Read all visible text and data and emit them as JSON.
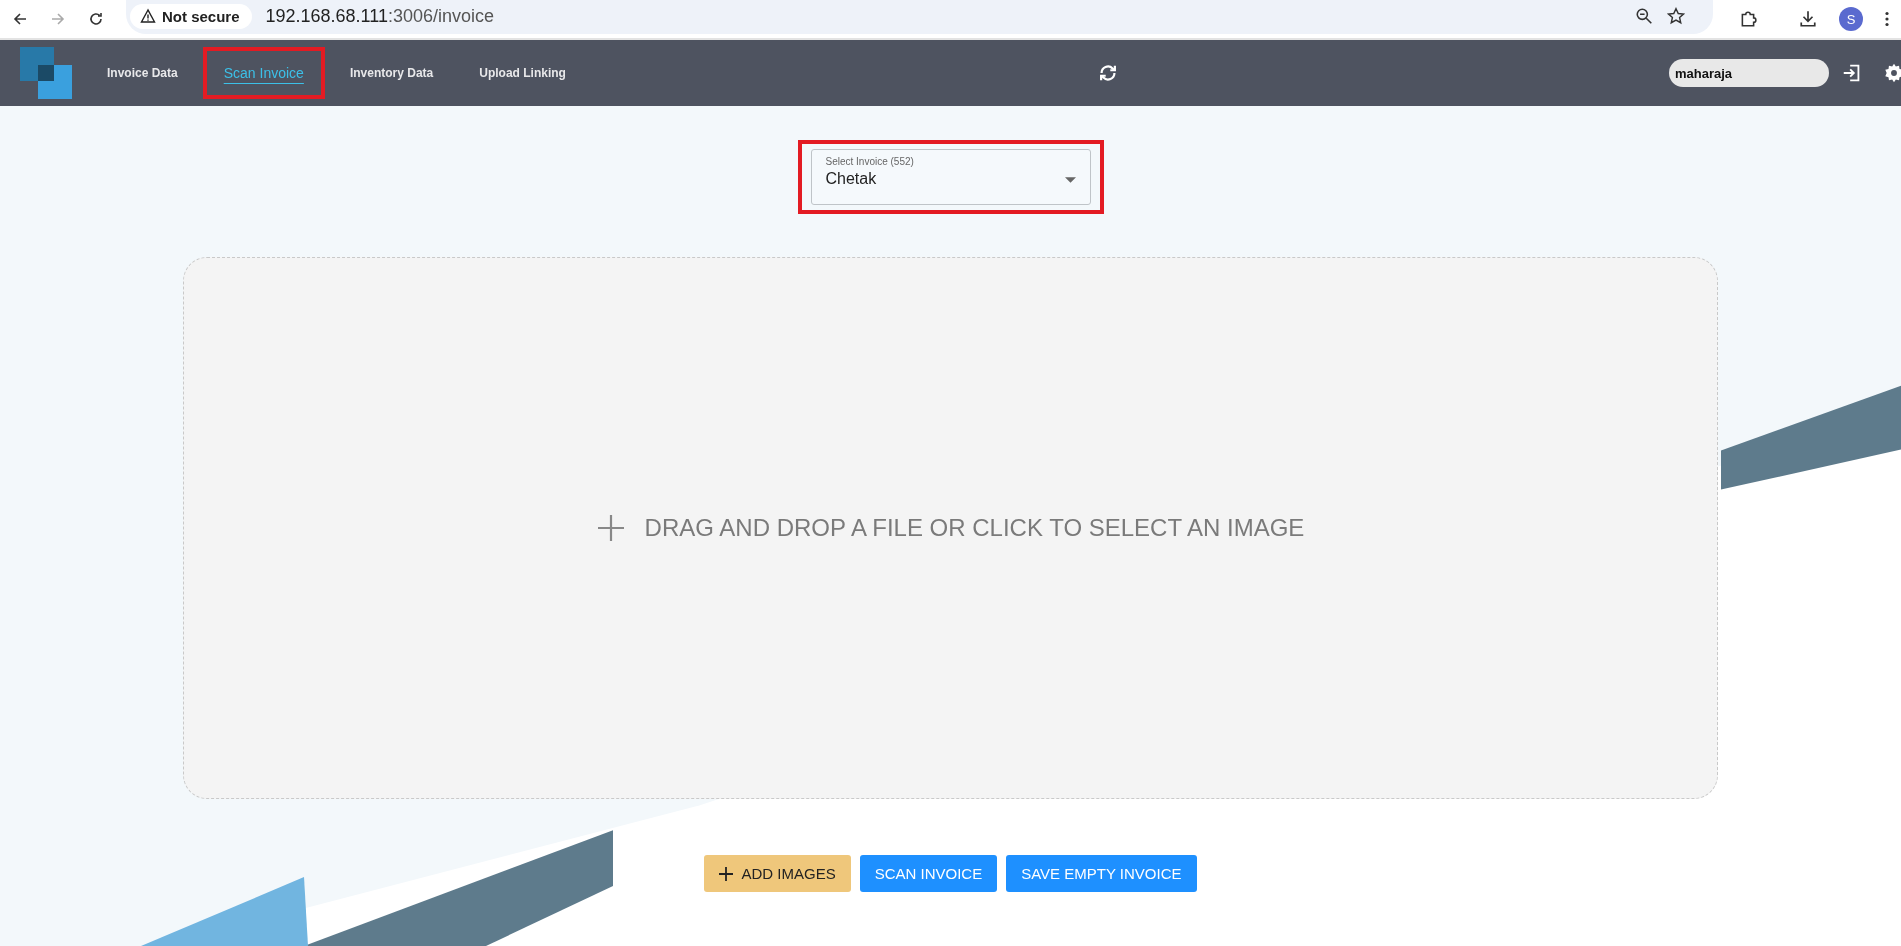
{
  "browser": {
    "back_disabled": false,
    "forward_disabled": true,
    "security": "Not secure",
    "url_host": "192.168.68.111",
    "url_path": ":3006/invoice",
    "avatar": "S"
  },
  "nav": {
    "items": [
      {
        "label": "Invoice Data",
        "selected": false,
        "highlighted": false
      },
      {
        "label": "Scan Invoice",
        "selected": true,
        "highlighted": true
      },
      {
        "label": "Inventory Data",
        "selected": false,
        "highlighted": false
      },
      {
        "label": "Upload Linking",
        "selected": false,
        "highlighted": false
      }
    ],
    "user": "maharaja"
  },
  "select": {
    "label": "Select Invoice (552)",
    "value": "Chetak",
    "highlighted": true
  },
  "dropzone": {
    "text": "DRAG AND DROP A FILE OR CLICK TO SELECT AN IMAGE"
  },
  "buttons": [
    {
      "label": "ADD IMAGES",
      "kind": "add"
    },
    {
      "label": "SCAN INVOICE",
      "kind": "primary"
    },
    {
      "label": "SAVE EMPTY INVOICE",
      "kind": "primary"
    }
  ]
}
